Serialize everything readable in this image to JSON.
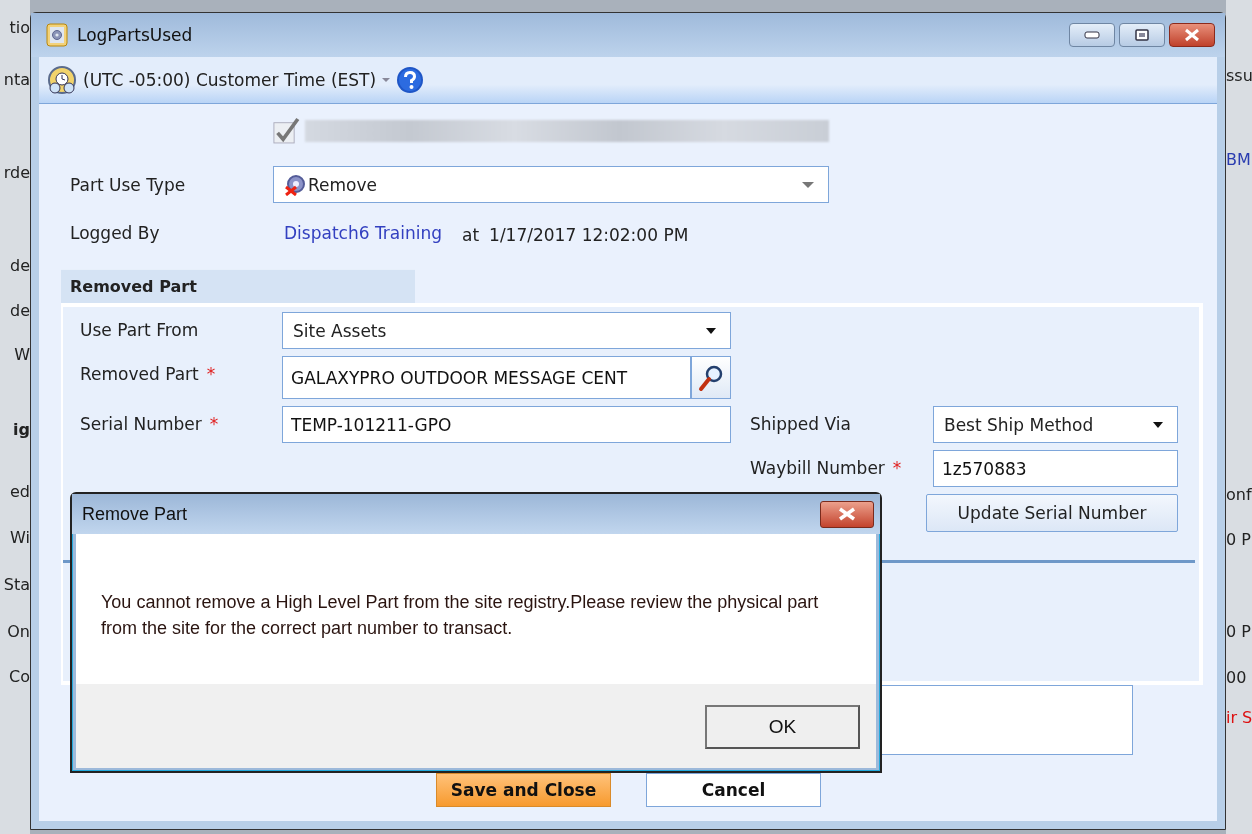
{
  "background": {
    "left_fragments": [
      "tio",
      "nta",
      "rde",
      "de",
      "de",
      "W",
      "ig",
      "ed",
      "Wi",
      "Sta",
      "On",
      "Co"
    ],
    "right_fragments": [
      "ssu",
      "BM",
      "onf",
      "0 P",
      "0 P",
      "00",
      "ir S"
    ]
  },
  "window": {
    "title": "LogPartsUsed",
    "timezone": "(UTC -05:00) Customer Time (EST)",
    "checkbox": {
      "checked": true,
      "disabled": true
    },
    "part_use_type": {
      "label": "Part Use Type",
      "value": "Remove"
    },
    "logged_by": {
      "label": "Logged By",
      "user": "Dispatch6 Training",
      "at": "at",
      "time": "1/17/2017 12:02:00 PM"
    },
    "section": {
      "title": "Removed Part"
    },
    "fields": [
      {
        "kind": "select",
        "label": "Use Part From",
        "value": "Site Assets"
      },
      {
        "kind": "lookup",
        "label": "Removed Part",
        "required_mark": "*",
        "value": "GALAXYPRO OUTDOOR MESSAGE CENT"
      },
      {
        "kind": "text",
        "label": "Serial Number",
        "required_mark": "*",
        "value": "TEMP-101211-GPO"
      }
    ],
    "shipping_fields": [
      {
        "kind": "select",
        "label": "Shipped Via",
        "value": "Best Ship Method"
      },
      {
        "kind": "text",
        "label": "Waybill Number",
        "required_mark": "*",
        "value": "1z570883"
      }
    ],
    "update_button": "Update Serial Number",
    "buttons": [
      {
        "label": "Save and Close",
        "primary": true
      },
      {
        "label": "Cancel",
        "primary": false
      }
    ]
  },
  "dialog": {
    "title": "Remove Part",
    "message": "You cannot remove a High Level Part from the site registry.Please review the physical part from the site for the correct part number to transact.",
    "button": "OK"
  }
}
